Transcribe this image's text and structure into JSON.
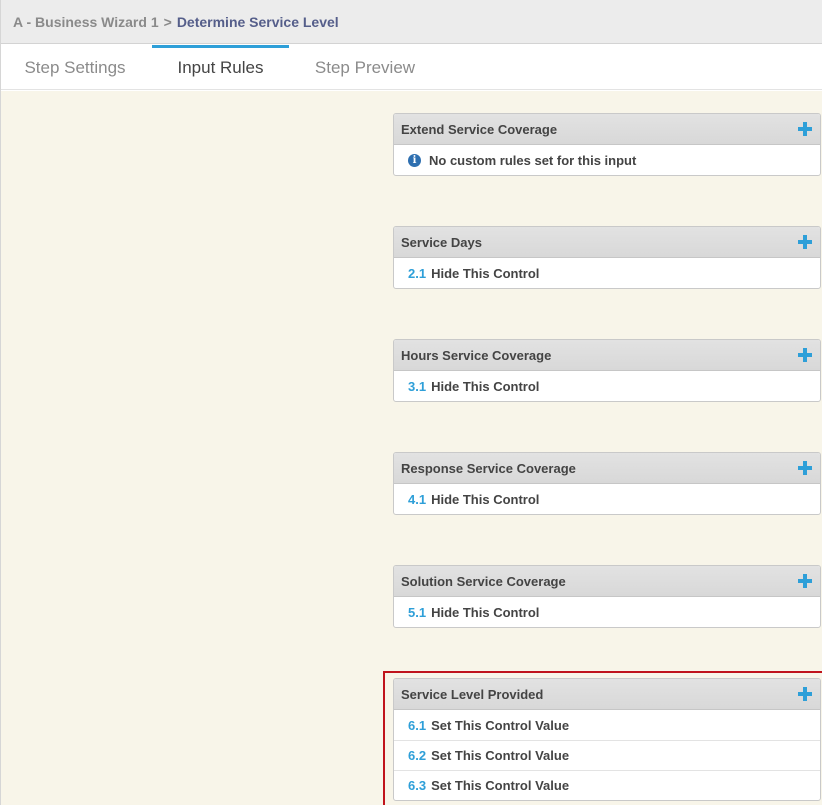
{
  "breadcrumb": {
    "parent": "A - Business Wizard 1",
    "separator": ">",
    "current": "Determine Service Level"
  },
  "tabs": [
    {
      "label": "Step Settings",
      "active": false
    },
    {
      "label": "Input Rules",
      "active": true
    },
    {
      "label": "Step Preview",
      "active": false
    }
  ],
  "colors": {
    "accent": "#2e9fd8",
    "content_bg": "#f8f5e9",
    "highlight": "#c0141c"
  },
  "cards": [
    {
      "title": "Extend Service Coverage",
      "empty_message": "No custom rules set for this input",
      "rules": []
    },
    {
      "title": "Service Days",
      "rules": [
        {
          "num": "2.1",
          "label": "Hide This Control"
        }
      ]
    },
    {
      "title": "Hours Service Coverage",
      "rules": [
        {
          "num": "3.1",
          "label": "Hide This Control"
        }
      ]
    },
    {
      "title": "Response Service Coverage",
      "rules": [
        {
          "num": "4.1",
          "label": "Hide This Control"
        }
      ]
    },
    {
      "title": "Solution Service Coverage",
      "rules": [
        {
          "num": "5.1",
          "label": "Hide This Control"
        }
      ]
    },
    {
      "title": "Service Level Provided",
      "highlighted": true,
      "rules": [
        {
          "num": "6.1",
          "label": "Set This Control Value"
        },
        {
          "num": "6.2",
          "label": "Set This Control Value"
        },
        {
          "num": "6.3",
          "label": "Set This Control Value"
        }
      ]
    }
  ]
}
